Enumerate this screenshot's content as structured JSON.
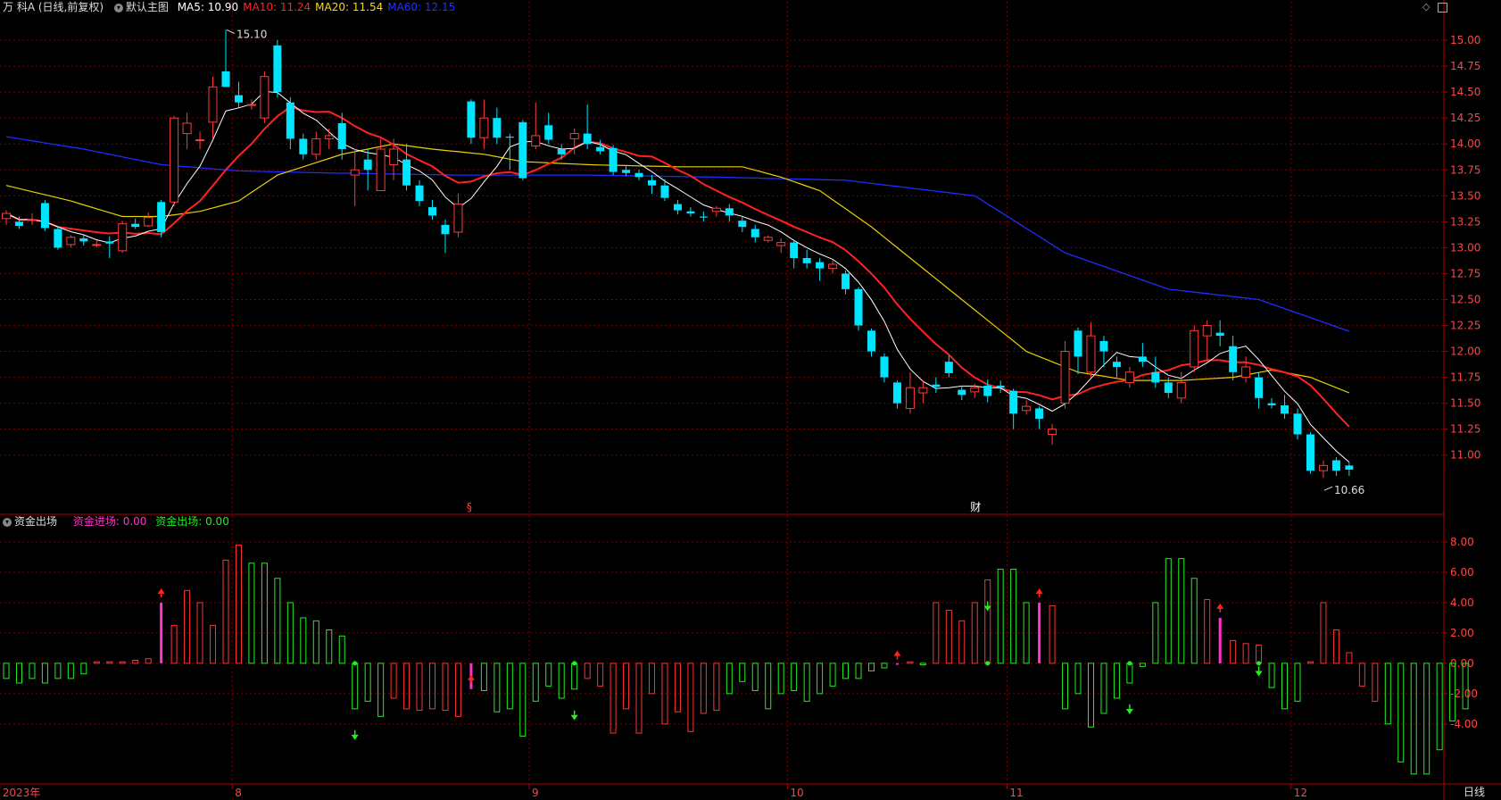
{
  "header": {
    "stock_name": "万 科A (日线,前复权)",
    "template_label": "默认主图",
    "ma_items": [
      {
        "label": "MA5: 10.90",
        "color": "#ffffff"
      },
      {
        "label": "MA10: 11.24",
        "color": "#ff2222"
      },
      {
        "label": "MA20: 11.54",
        "color": "#ffd800"
      },
      {
        "label": "MA60: 12.15",
        "color": "#2233ff"
      }
    ]
  },
  "indicator_header": {
    "name": "资金出场",
    "inflow_label": "资金进场: 0.00",
    "outflow_label": "资金出场: 0.00",
    "inflow_color": "#ff33cc",
    "outflow_color": "#22ee22"
  },
  "period_label": "日线",
  "colors": {
    "up": "#ff3b3b",
    "down": "#00e5ff",
    "ma5": "#ffffff",
    "ma10": "#ff2222",
    "ma20": "#e6d200",
    "ma60": "#1f2cff",
    "grid": "#7a0000",
    "axis_text": "#ff4444",
    "date_text": "#ff4444",
    "ind_up": "#ff3333",
    "ind_down": "#22ee22",
    "ind_in": "#ff33cc"
  },
  "chart_data": [
    {
      "type": "candlestick",
      "title": "万 科A (日线,前复权)",
      "y_ticks": [
        "15.00",
        "14.75",
        "14.50",
        "14.25",
        "14.00",
        "13.75",
        "13.50",
        "13.25",
        "13.00",
        "12.75",
        "12.50",
        "12.25",
        "12.00",
        "11.75",
        "11.50",
        "11.25",
        "11.00"
      ],
      "ylim": [
        10.55,
        15.25
      ],
      "x_labels": [
        {
          "text": "2023年",
          "index": 0
        },
        {
          "text": "8",
          "index": 18
        },
        {
          "text": "9",
          "index": 41
        },
        {
          "text": "10",
          "index": 61
        },
        {
          "text": "11",
          "index": 78
        },
        {
          "text": "12",
          "index": 100
        }
      ],
      "annotations": [
        {
          "text": "15.10",
          "type": "high",
          "index": 17,
          "value": 15.1
        },
        {
          "text": "10.66",
          "type": "low",
          "index": 102,
          "value": 10.66
        }
      ],
      "event_markers": [
        {
          "text": "§",
          "index": 36,
          "color": "#ff4444"
        },
        {
          "text": "财",
          "index": 75,
          "color": "#ffffff"
        }
      ],
      "candles": [
        [
          13.28,
          13.33,
          13.36,
          13.22
        ],
        [
          13.25,
          13.21,
          13.3,
          13.18
        ],
        [
          13.27,
          13.27,
          13.33,
          13.22
        ],
        [
          13.43,
          13.19,
          13.46,
          13.16
        ],
        [
          13.18,
          13.0,
          13.2,
          12.98
        ],
        [
          13.03,
          13.1,
          13.12,
          13.0
        ],
        [
          13.09,
          13.06,
          13.12,
          13.02
        ],
        [
          13.03,
          13.03,
          13.07,
          13.0
        ],
        [
          13.06,
          13.04,
          13.11,
          12.9
        ],
        [
          12.97,
          13.23,
          13.26,
          12.95
        ],
        [
          13.23,
          13.2,
          13.28,
          13.18
        ],
        [
          13.21,
          13.29,
          13.34,
          13.2
        ],
        [
          13.44,
          13.15,
          13.46,
          13.1
        ],
        [
          13.44,
          14.25,
          14.27,
          13.4
        ],
        [
          14.1,
          14.2,
          14.3,
          13.95
        ],
        [
          14.04,
          14.04,
          14.12,
          13.95
        ],
        [
          14.21,
          14.55,
          14.65,
          14.05
        ],
        [
          14.7,
          14.55,
          15.1,
          14.55
        ],
        [
          14.47,
          14.4,
          14.6,
          14.35
        ],
        [
          14.38,
          14.38,
          14.43,
          14.33
        ],
        [
          14.25,
          14.65,
          14.7,
          14.2
        ],
        [
          14.95,
          14.5,
          15.0,
          14.45
        ],
        [
          14.4,
          14.05,
          14.45,
          13.95
        ],
        [
          14.05,
          13.9,
          14.1,
          13.85
        ],
        [
          13.9,
          14.05,
          14.12,
          13.85
        ],
        [
          14.05,
          14.08,
          14.15,
          13.95
        ],
        [
          14.2,
          13.95,
          14.3,
          13.85
        ],
        [
          13.7,
          13.75,
          13.95,
          13.4
        ],
        [
          13.85,
          13.75,
          13.95,
          13.55
        ],
        [
          13.55,
          13.95,
          14.05,
          13.55
        ],
        [
          13.8,
          13.95,
          14.05,
          13.65
        ],
        [
          13.85,
          13.6,
          14.0,
          13.55
        ],
        [
          13.6,
          13.45,
          13.65,
          13.4
        ],
        [
          13.39,
          13.31,
          13.46,
          13.27
        ],
        [
          13.22,
          13.13,
          13.27,
          12.95
        ],
        [
          13.15,
          13.42,
          13.52,
          13.1
        ],
        [
          14.41,
          14.06,
          14.43,
          14.0
        ],
        [
          14.06,
          14.25,
          14.43,
          13.95
        ],
        [
          14.25,
          14.06,
          14.35,
          14.0
        ],
        [
          14.07,
          14.06,
          14.1,
          13.75
        ],
        [
          14.21,
          13.67,
          14.23,
          13.65
        ],
        [
          13.98,
          14.08,
          14.4,
          13.95
        ],
        [
          14.18,
          14.04,
          14.3,
          14.0
        ],
        [
          13.95,
          13.9,
          14.0,
          13.85
        ],
        [
          14.05,
          14.1,
          14.15,
          13.9
        ],
        [
          14.1,
          14.0,
          14.38,
          13.95
        ],
        [
          13.97,
          13.93,
          14.04,
          13.9
        ],
        [
          13.96,
          13.73,
          13.99,
          13.7
        ],
        [
          13.75,
          13.72,
          13.79,
          13.69
        ],
        [
          13.72,
          13.68,
          13.75,
          13.65
        ],
        [
          13.65,
          13.6,
          13.7,
          13.52
        ],
        [
          13.6,
          13.48,
          13.66,
          13.45
        ],
        [
          13.42,
          13.36,
          13.46,
          13.32
        ],
        [
          13.35,
          13.33,
          13.39,
          13.3
        ],
        [
          13.3,
          13.29,
          13.35,
          13.25
        ],
        [
          13.35,
          13.38,
          13.4,
          13.3
        ],
        [
          13.38,
          13.31,
          13.42,
          13.25
        ],
        [
          13.26,
          13.2,
          13.3,
          13.15
        ],
        [
          13.18,
          13.1,
          13.22,
          13.05
        ],
        [
          13.07,
          13.1,
          13.12,
          13.05
        ],
        [
          13.02,
          13.05,
          13.09,
          12.95
        ],
        [
          13.05,
          12.9,
          13.08,
          12.8
        ],
        [
          12.9,
          12.85,
          12.98,
          12.8
        ],
        [
          12.86,
          12.8,
          12.9,
          12.68
        ],
        [
          12.8,
          12.84,
          12.88,
          12.75
        ],
        [
          12.75,
          12.6,
          12.78,
          12.55
        ],
        [
          12.6,
          12.25,
          12.62,
          12.2
        ],
        [
          12.2,
          12.0,
          12.22,
          11.95
        ],
        [
          11.95,
          11.75,
          11.98,
          11.7
        ],
        [
          11.7,
          11.5,
          11.72,
          11.45
        ],
        [
          11.45,
          11.65,
          11.8,
          11.4
        ],
        [
          11.6,
          11.65,
          11.72,
          11.5
        ],
        [
          11.68,
          11.66,
          11.75,
          11.6
        ],
        [
          11.9,
          11.79,
          11.96,
          11.75
        ],
        [
          11.63,
          11.58,
          11.67,
          11.53
        ],
        [
          11.61,
          11.65,
          11.69,
          11.55
        ],
        [
          11.67,
          11.57,
          11.73,
          11.51
        ],
        [
          11.67,
          11.65,
          11.72,
          11.6
        ],
        [
          11.62,
          11.4,
          11.64,
          11.25
        ],
        [
          11.43,
          11.47,
          11.53,
          11.39
        ],
        [
          11.45,
          11.35,
          11.47,
          11.25
        ],
        [
          11.2,
          11.25,
          11.3,
          11.1
        ],
        [
          11.5,
          12.0,
          12.1,
          11.45
        ],
        [
          12.2,
          11.95,
          12.23,
          11.78
        ],
        [
          11.8,
          12.15,
          12.28,
          11.75
        ],
        [
          12.1,
          12.0,
          12.15,
          11.85
        ],
        [
          11.9,
          11.85,
          11.95,
          11.75
        ],
        [
          11.7,
          11.8,
          11.85,
          11.65
        ],
        [
          11.95,
          11.9,
          12.08,
          11.85
        ],
        [
          11.8,
          11.7,
          11.95,
          11.65
        ],
        [
          11.7,
          11.6,
          11.75,
          11.55
        ],
        [
          11.55,
          11.7,
          11.8,
          11.5
        ],
        [
          11.85,
          12.2,
          12.25,
          11.8
        ],
        [
          12.15,
          12.25,
          12.3,
          11.9
        ],
        [
          12.18,
          12.15,
          12.3,
          12.05
        ],
        [
          12.05,
          11.8,
          12.15,
          11.72
        ],
        [
          11.75,
          11.85,
          11.95,
          11.7
        ],
        [
          11.75,
          11.55,
          11.8,
          11.45
        ],
        [
          11.5,
          11.48,
          11.55,
          11.45
        ],
        [
          11.48,
          11.4,
          11.58,
          11.35
        ],
        [
          11.4,
          11.2,
          11.45,
          11.15
        ],
        [
          11.2,
          10.85,
          11.22,
          10.82
        ],
        [
          10.85,
          10.9,
          10.95,
          10.78
        ],
        [
          10.95,
          10.85,
          10.98,
          10.8
        ],
        [
          10.9,
          10.86,
          10.93,
          10.8
        ]
      ],
      "ma60_knots": [
        [
          0,
          14.07
        ],
        [
          6,
          13.95
        ],
        [
          12,
          13.8
        ],
        [
          18,
          13.74
        ],
        [
          25,
          13.72
        ],
        [
          35,
          13.7
        ],
        [
          45,
          13.7
        ],
        [
          55,
          13.68
        ],
        [
          65,
          13.65
        ],
        [
          75,
          13.5
        ],
        [
          82,
          12.95
        ],
        [
          90,
          12.6
        ],
        [
          97,
          12.5
        ],
        [
          105,
          12.15
        ]
      ],
      "ma20_knots": [
        [
          0,
          13.6
        ],
        [
          5,
          13.45
        ],
        [
          9,
          13.3
        ],
        [
          12,
          13.3
        ],
        [
          15,
          13.35
        ],
        [
          18,
          13.45
        ],
        [
          21,
          13.7
        ],
        [
          26,
          13.9
        ],
        [
          30,
          14.0
        ],
        [
          33,
          13.95
        ],
        [
          37,
          13.9
        ],
        [
          40,
          13.83
        ],
        [
          45,
          13.8
        ],
        [
          52,
          13.78
        ],
        [
          57,
          13.78
        ],
        [
          60,
          13.68
        ],
        [
          63,
          13.55
        ],
        [
          67,
          13.2
        ],
        [
          71,
          12.8
        ],
        [
          75,
          12.4
        ],
        [
          79,
          12.0
        ],
        [
          83,
          11.8
        ],
        [
          87,
          11.72
        ],
        [
          91,
          11.72
        ],
        [
          95,
          11.75
        ],
        [
          98,
          11.82
        ],
        [
          101,
          11.75
        ],
        [
          105,
          11.55
        ]
      ],
      "legend": [
        "MA5",
        "MA10",
        "MA20",
        "MA60"
      ]
    },
    {
      "type": "bar",
      "title": "资金出场",
      "y_ticks": [
        "8.00",
        "6.00",
        "4.00",
        "2.00",
        "0.00",
        "-2.00",
        "-4.00"
      ],
      "ylim": [
        -7.6,
        9.0
      ],
      "values": [
        -1,
        -1.3,
        -1,
        -1.3,
        -1,
        -1,
        -0.7,
        0.1,
        0.1,
        0.1,
        0.2,
        0.3,
        4,
        2.5,
        4.8,
        4,
        2.5,
        6.8,
        7.8,
        6.6,
        6.6,
        5.6,
        4,
        3,
        2.8,
        2.2,
        1.8,
        -3,
        -2.5,
        -3.5,
        -2.3,
        -3,
        -3.1,
        -3,
        -3.1,
        -3.5,
        -1.7,
        -1.8,
        -3.2,
        -3,
        -4.8,
        -2.5,
        -1.5,
        -2.3,
        -1.7,
        -1,
        -1.5,
        -4.6,
        -3,
        -4.6,
        -2,
        -4,
        -3.2,
        -4.5,
        -3.3,
        -3.1,
        -2,
        -1.2,
        -1.8,
        -3,
        -2,
        -1.8,
        -2.5,
        -2,
        -1.5,
        -1,
        -1,
        -0.5,
        -0.3,
        -0.1,
        0.1,
        -0.1,
        4,
        3.5,
        2.8,
        4,
        5.5,
        6.2,
        6.2,
        4,
        4,
        3.8,
        -3,
        -2,
        -4.2,
        -3.3,
        -2.3,
        -1.3,
        -0.2,
        4,
        6.9,
        6.9,
        5.6,
        4.2,
        3,
        1.5,
        1.3,
        1.2,
        -1.6,
        -3,
        -2.5,
        0.1,
        4,
        2.2,
        0.7,
        -1.5,
        -2.5,
        -4,
        -6.5,
        -7.3,
        -7.3,
        -5.7,
        -3.8,
        -3
      ],
      "inflow_markers": [
        12,
        36,
        69,
        80,
        94
      ],
      "outflow_markers": [
        27,
        44,
        76,
        87,
        97
      ],
      "legend": [
        "资金进场",
        "资金出场"
      ]
    }
  ]
}
